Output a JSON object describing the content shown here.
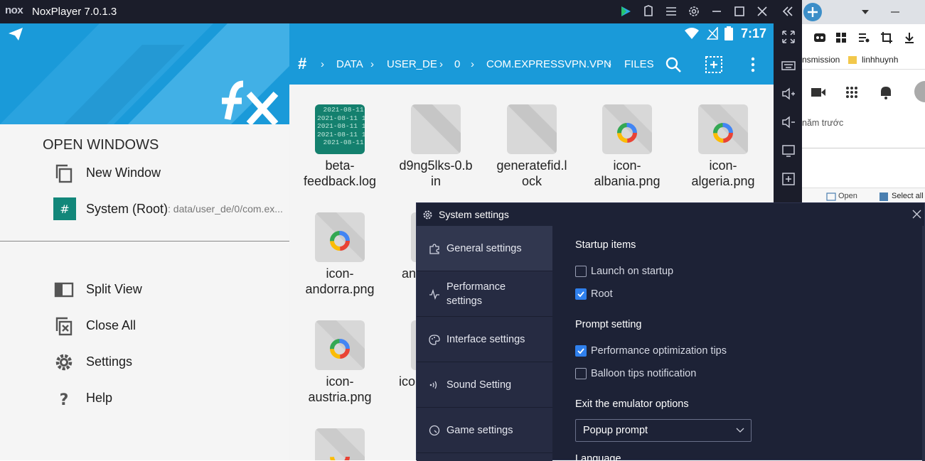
{
  "window": {
    "logo": "nox",
    "title": "NoxPlayer 7.0.1.3"
  },
  "statusbar": {
    "time": "7:17"
  },
  "drawer": {
    "section_title": "OPEN WINDOWS",
    "items": [
      {
        "label": "New Window"
      },
      {
        "label": "System (Root)",
        "sublabel": ": data/user_de/0/com.ex..."
      },
      {
        "label": "Split View"
      },
      {
        "label": "Close All"
      },
      {
        "label": "Settings"
      },
      {
        "label": "Help"
      }
    ]
  },
  "pathbar": {
    "root": "#",
    "segments": [
      "DATA",
      "USER_DE",
      "0",
      "COM.EXPRESSVPN.VPN",
      "FILES"
    ]
  },
  "files": [
    {
      "name_l1": "beta-",
      "name_l2": "feedback.log",
      "log_lines": [
        "2021-08-11",
        "2021-08-11 18",
        "2021-08-11 18",
        "2021-08-11 18",
        "2021-08-11"
      ]
    },
    {
      "name_l1": "d9ng5lks-0.b",
      "name_l2": "in"
    },
    {
      "name_l1": "generatefid.l",
      "name_l2": "ock"
    },
    {
      "name_l1": "icon-",
      "name_l2": "albania.png"
    },
    {
      "name_l1": "icon-",
      "name_l2": "algeria.png"
    },
    {
      "name_l1": "icon-",
      "name_l2": "andorra.png"
    },
    {
      "name_l1": "an",
      "name_l2": ""
    },
    {
      "name_l1": "icon-",
      "name_l2": "austria.png"
    },
    {
      "name_l1": "ico",
      "name_l2": ""
    }
  ],
  "browser": {
    "bookmark_1": "nsmission",
    "bookmark_2": "linhhuynh",
    "text_1": "năm trước",
    "open_label": "Open",
    "select_all_label": "Select all"
  },
  "dialog": {
    "title": "System settings",
    "nav": [
      {
        "label": "General settings",
        "active": true
      },
      {
        "label_l1": "Performance",
        "label_l2": "settings"
      },
      {
        "label": "Interface settings"
      },
      {
        "label": "Sound Setting"
      },
      {
        "label": "Game settings"
      }
    ],
    "startup_title": "Startup items",
    "launch_on_startup": "Launch on startup",
    "root": "Root",
    "prompt_title": "Prompt setting",
    "perf_tips": "Performance optimization tips",
    "balloon_tips": "Balloon tips notification",
    "exit_title": "Exit the emulator options",
    "exit_value": "Popup prompt",
    "language_title": "Language"
  },
  "colors": {
    "accent": "#1a9ad9",
    "dialog_bg": "#1d2236",
    "checkbox_on": "#2f80ed"
  }
}
